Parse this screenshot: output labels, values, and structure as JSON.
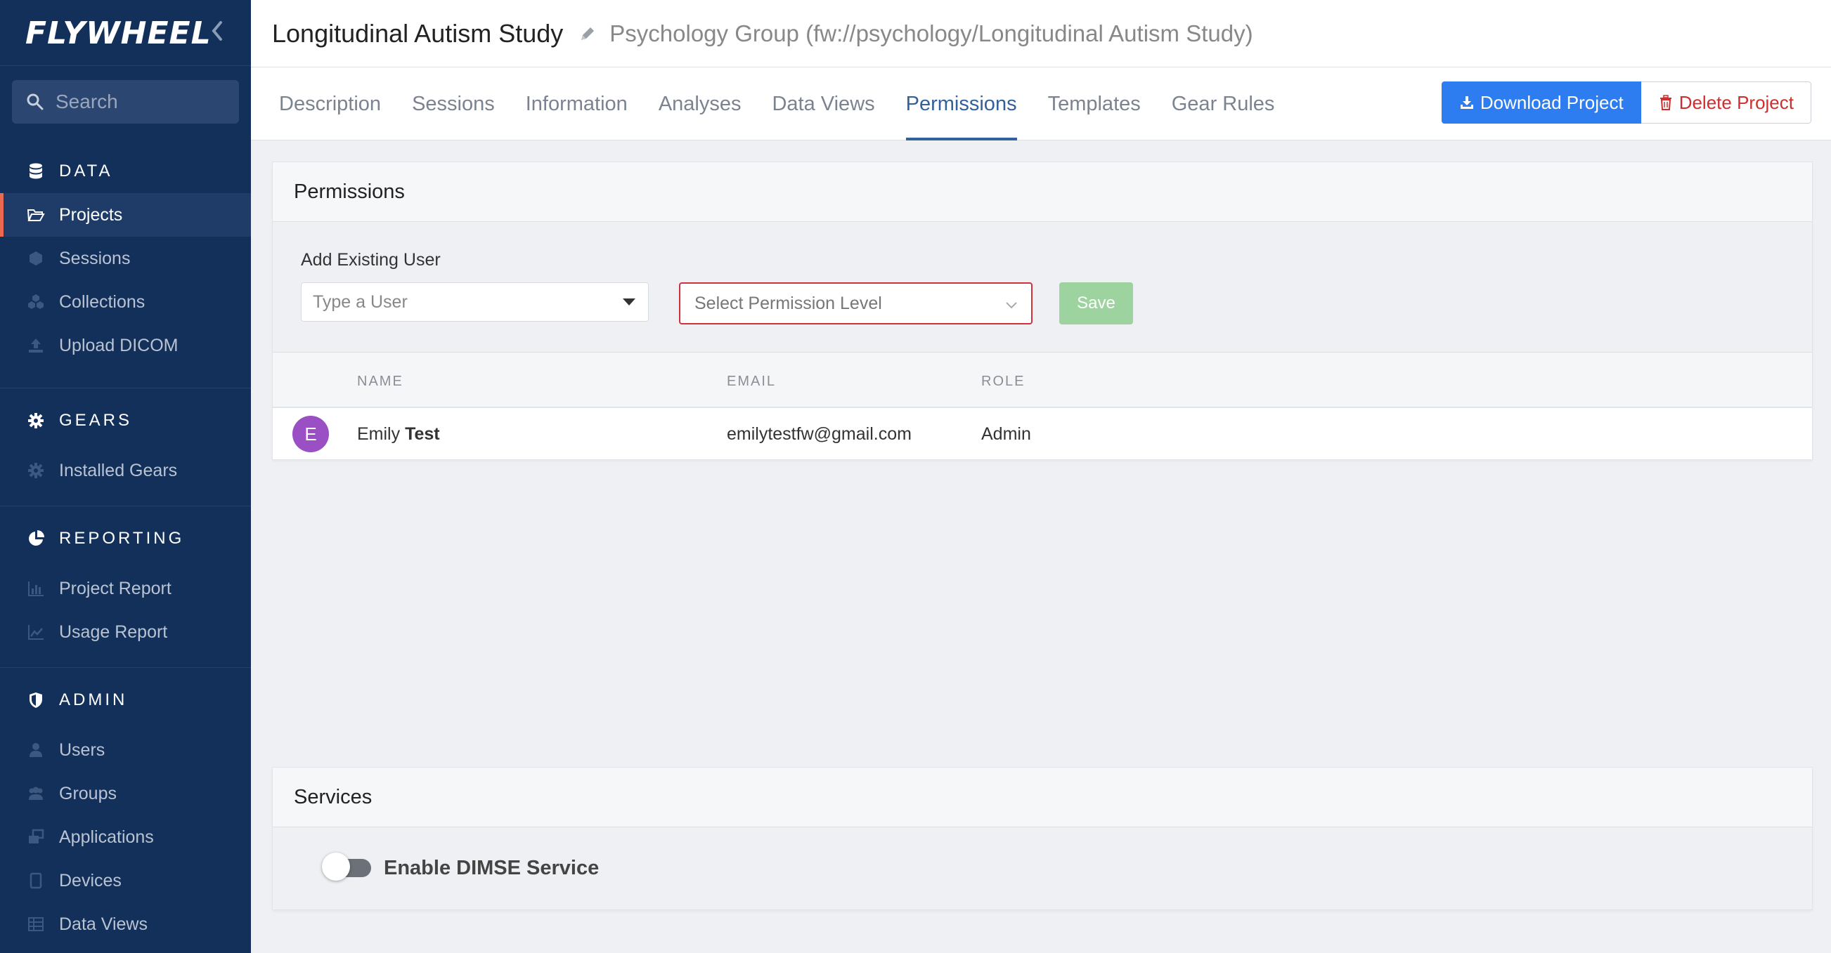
{
  "sidebar": {
    "logo": "FLYWHEEL",
    "search_placeholder": "Search",
    "sections": [
      {
        "heading": "DATA",
        "icon": "database-icon",
        "items": [
          {
            "label": "Projects",
            "icon": "folder-open-icon",
            "active": true
          },
          {
            "label": "Sessions",
            "icon": "cube-icon"
          },
          {
            "label": "Collections",
            "icon": "cubes-icon"
          },
          {
            "label": "Upload DICOM",
            "icon": "upload-icon"
          }
        ]
      },
      {
        "heading": "GEARS",
        "icon": "gear-icon",
        "items": [
          {
            "label": "Installed Gears",
            "icon": "gear-icon"
          }
        ]
      },
      {
        "heading": "REPORTING",
        "icon": "pie-chart-icon",
        "items": [
          {
            "label": "Project Report",
            "icon": "bar-chart-icon"
          },
          {
            "label": "Usage Report",
            "icon": "line-chart-icon"
          }
        ]
      },
      {
        "heading": "ADMIN",
        "icon": "shield-icon",
        "items": [
          {
            "label": "Users",
            "icon": "user-icon"
          },
          {
            "label": "Groups",
            "icon": "users-icon"
          },
          {
            "label": "Applications",
            "icon": "windows-icon"
          },
          {
            "label": "Devices",
            "icon": "tablet-icon"
          },
          {
            "label": "Data Views",
            "icon": "table-icon"
          }
        ]
      }
    ]
  },
  "header": {
    "title": "Longitudinal Autism Study",
    "subtitle": "Psychology Group (fw://psychology/Longitudinal Autism Study)"
  },
  "tabs": [
    "Description",
    "Sessions",
    "Information",
    "Analyses",
    "Data Views",
    "Permissions",
    "Templates",
    "Gear Rules"
  ],
  "active_tab": "Permissions",
  "actions": {
    "download": "Download Project",
    "delete": "Delete Project"
  },
  "permissions": {
    "heading": "Permissions",
    "add_label": "Add Existing User",
    "user_placeholder": "Type a User",
    "level_placeholder": "Select Permission Level",
    "save": "Save",
    "columns": {
      "name": "NAME",
      "email": "EMAIL",
      "role": "ROLE"
    },
    "users": [
      {
        "initial": "E",
        "first": "Emily",
        "last": "Test",
        "email": "emilytestfw@gmail.com",
        "role": "Admin",
        "avatar_color": "#9a4fc4"
      }
    ]
  },
  "services": {
    "heading": "Services",
    "dimse_label": "Enable DIMSE Service",
    "dimse_enabled": false
  },
  "colors": {
    "sidebar_bg": "#13305a",
    "accent": "#e96a50",
    "primary": "#2d7cf0",
    "danger": "#cf2e2e",
    "active_tab": "#33619b"
  }
}
